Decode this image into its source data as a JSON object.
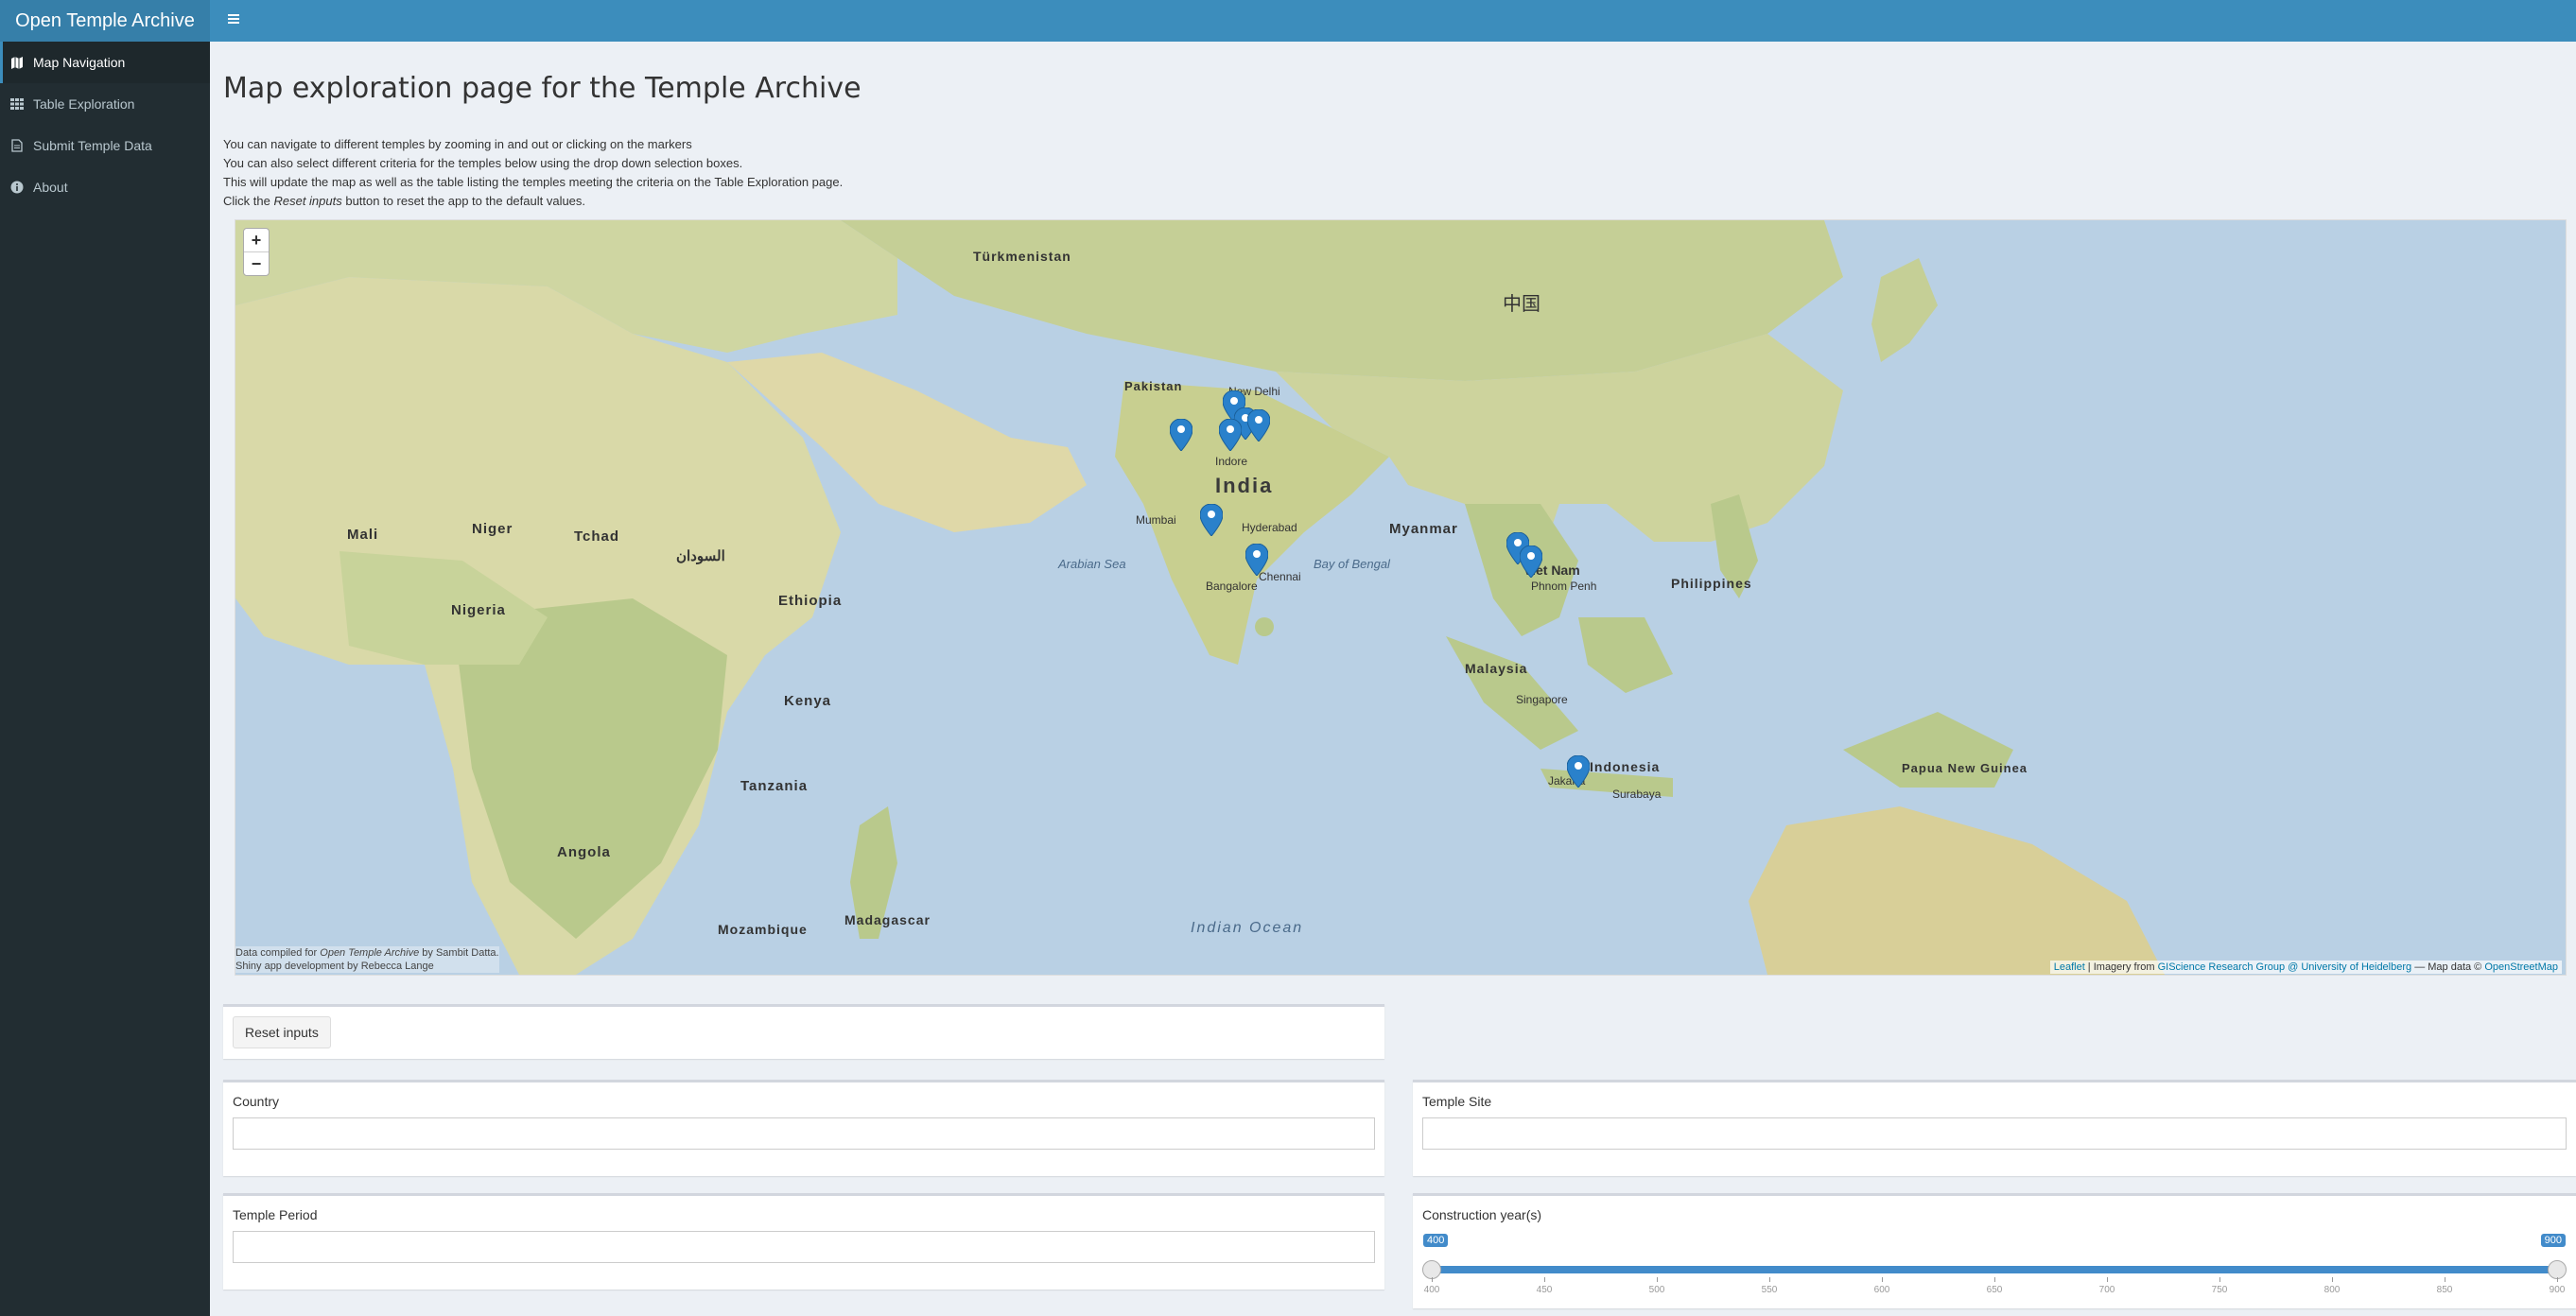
{
  "header": {
    "app_title": "Open Temple Archive",
    "toggle_icon": "hamburger-icon"
  },
  "sidebar": {
    "items": [
      {
        "label": "Map Navigation",
        "icon": "map-icon",
        "active": true
      },
      {
        "label": "Table Exploration",
        "icon": "table-icon",
        "active": false
      },
      {
        "label": "Submit Temple Data",
        "icon": "file-icon",
        "active": false
      },
      {
        "label": "About",
        "icon": "info-icon",
        "active": false
      }
    ]
  },
  "main": {
    "title": "Map exploration page for the Temple Archive",
    "intro": {
      "line1": "You can navigate to different temples by zooming in and out or clicking on the markers",
      "line2": "You can also select different criteria for the temples below using the drop down selection boxes.",
      "line3": "This will update the map as well as the table listing the temples meeting the criteria on the Table Exploration page.",
      "line4_pre": "Click the ",
      "line4_em": "Reset inputs",
      "line4_post": " button to reset the app to the default values."
    }
  },
  "map": {
    "zoom_in": "+",
    "zoom_out": "−",
    "attribution_left_pre": "Data compiled for ",
    "attribution_left_em": "Open Temple Archive",
    "attribution_left_post": " by Sambit Datta.",
    "attribution_left2": "Shiny app development by Rebecca Lange",
    "attribution_leaflet": "Leaflet",
    "attribution_mid": " | Imagery from ",
    "attribution_gis": "GIScience Research Group @ University of Heidelberg",
    "attribution_dash": " — Map data © ",
    "attribution_osm": "OpenStreetMap",
    "labels": {
      "india": "India",
      "pakistan": "Pakistan",
      "myanmar": "Myanmar",
      "indonesia": "Indonesia",
      "malaysia": "Malaysia",
      "philippines": "Philippines",
      "bay_bengal": "Bay of Bengal",
      "arabian_sea": "Arabian Sea",
      "indian_ocean": "Indian Ocean",
      "tanzania": "Tanzania",
      "kenya": "Kenya",
      "madagascar": "Madagascar",
      "angola": "Angola",
      "mozambique": "Mozambique",
      "nigeria": "Nigeria",
      "mali": "Mali",
      "niger": "Niger",
      "tchad": "Tchad",
      "ethiopia": "Ethiopia",
      "sudan": "السودان",
      "turkmenistan": "Türkmenistan",
      "china": "中国",
      "papua": "Papua New Guinea",
      "bangalore": "Bangalore",
      "hyderabad": "Hyderabad",
      "mumbai": "Mumbai",
      "new_delhi": "New Delhi",
      "indore": "Indore",
      "chennai": "Chennai",
      "singapore": "Singapore",
      "jakarta": "Jakarta",
      "surabaya": "Surabaya",
      "viet_nam": "Viet Nam",
      "phnom_penh": "Phnom Penh"
    },
    "marker_color": "#2a81cb"
  },
  "controls": {
    "reset_label": "Reset inputs",
    "country_label": "Country",
    "site_label": "Temple Site",
    "period_label": "Temple Period",
    "year_label": "Construction year(s)",
    "slider": {
      "min": 400,
      "max": 900,
      "low": 400,
      "high": 900,
      "low_text": "400",
      "high_text": "900",
      "ticks": [
        "400",
        "450",
        "500",
        "550",
        "600",
        "650",
        "700",
        "750",
        "800",
        "850",
        "900"
      ]
    }
  }
}
